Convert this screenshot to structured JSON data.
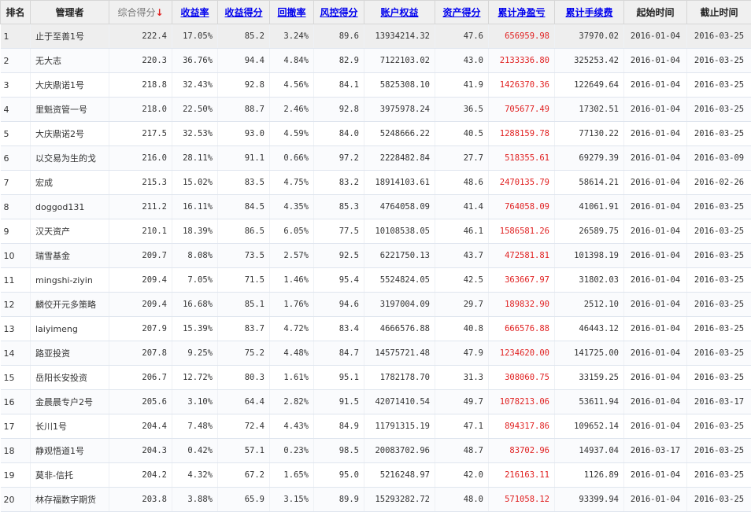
{
  "headers": [
    "排名",
    "管理者",
    "综合得分",
    "收益率",
    "收益得分",
    "回撤率",
    "风控得分",
    "账户权益",
    "资产得分",
    "累计净盈亏",
    "累计手续费",
    "起始时间",
    "截止时间"
  ],
  "sort_arrow": "↓",
  "rows": [
    [
      "1",
      "止于至善1号",
      "222.4",
      "17.05%",
      "85.2",
      "3.24%",
      "89.6",
      "13934214.32",
      "47.6",
      "656959.98",
      "37970.02",
      "2016-01-04",
      "2016-03-25"
    ],
    [
      "2",
      "无大志",
      "220.3",
      "36.76%",
      "94.4",
      "4.84%",
      "82.9",
      "7122103.02",
      "43.0",
      "2133336.80",
      "325253.42",
      "2016-01-04",
      "2016-03-25"
    ],
    [
      "3",
      "大庆鼎诺1号",
      "218.8",
      "32.43%",
      "92.8",
      "4.56%",
      "84.1",
      "5825308.10",
      "41.9",
      "1426370.36",
      "122649.64",
      "2016-01-04",
      "2016-03-25"
    ],
    [
      "4",
      "里魁资管一号",
      "218.0",
      "22.50%",
      "88.7",
      "2.46%",
      "92.8",
      "3975978.24",
      "36.5",
      "705677.49",
      "17302.51",
      "2016-01-04",
      "2016-03-25"
    ],
    [
      "5",
      "大庆鼎诺2号",
      "217.5",
      "32.53%",
      "93.0",
      "4.59%",
      "84.0",
      "5248666.22",
      "40.5",
      "1288159.78",
      "77130.22",
      "2016-01-04",
      "2016-03-25"
    ],
    [
      "6",
      "以交易为生的戈",
      "216.0",
      "28.11%",
      "91.1",
      "0.66%",
      "97.2",
      "2228482.84",
      "27.7",
      "518355.61",
      "69279.39",
      "2016-01-04",
      "2016-03-09"
    ],
    [
      "7",
      "宏成",
      "215.3",
      "15.02%",
      "83.5",
      "4.75%",
      "83.2",
      "18914103.61",
      "48.6",
      "2470135.79",
      "58614.21",
      "2016-01-04",
      "2016-02-26"
    ],
    [
      "8",
      "doggod131",
      "211.2",
      "16.11%",
      "84.5",
      "4.35%",
      "85.3",
      "4764058.09",
      "41.4",
      "764058.09",
      "41061.91",
      "2016-01-04",
      "2016-03-25"
    ],
    [
      "9",
      "汉天资产",
      "210.1",
      "18.39%",
      "86.5",
      "6.05%",
      "77.5",
      "10108538.05",
      "46.1",
      "1586581.26",
      "26589.75",
      "2016-01-04",
      "2016-03-25"
    ],
    [
      "10",
      "瑞雪基金",
      "209.7",
      "8.08%",
      "73.5",
      "2.57%",
      "92.5",
      "6221750.13",
      "43.7",
      "472581.81",
      "101398.19",
      "2016-01-04",
      "2016-03-25"
    ],
    [
      "11",
      "mingshi-ziyin",
      "209.4",
      "7.05%",
      "71.5",
      "1.46%",
      "95.4",
      "5524824.05",
      "42.5",
      "363667.97",
      "31802.03",
      "2016-01-04",
      "2016-03-25"
    ],
    [
      "12",
      "麟佼开元多策略",
      "209.4",
      "16.68%",
      "85.1",
      "1.76%",
      "94.6",
      "3197004.09",
      "29.7",
      "189832.90",
      "2512.10",
      "2016-01-04",
      "2016-03-25"
    ],
    [
      "13",
      "laiyimeng",
      "207.9",
      "15.39%",
      "83.7",
      "4.72%",
      "83.4",
      "4666576.88",
      "40.8",
      "666576.88",
      "46443.12",
      "2016-01-04",
      "2016-03-25"
    ],
    [
      "14",
      "路亚投资",
      "207.8",
      "9.25%",
      "75.2",
      "4.48%",
      "84.7",
      "14575721.48",
      "47.9",
      "1234620.00",
      "141725.00",
      "2016-01-04",
      "2016-03-25"
    ],
    [
      "15",
      "岳阳长安投资",
      "206.7",
      "12.72%",
      "80.3",
      "1.61%",
      "95.1",
      "1782178.70",
      "31.3",
      "308060.75",
      "33159.25",
      "2016-01-04",
      "2016-03-25"
    ],
    [
      "16",
      "金晨晨专户2号",
      "205.6",
      "3.10%",
      "64.4",
      "2.82%",
      "91.5",
      "42071410.54",
      "49.7",
      "1078213.06",
      "53611.94",
      "2016-01-04",
      "2016-03-17"
    ],
    [
      "17",
      "长川1号",
      "204.4",
      "7.48%",
      "72.4",
      "4.43%",
      "84.9",
      "11791315.19",
      "47.1",
      "894317.86",
      "109652.14",
      "2016-01-04",
      "2016-03-25"
    ],
    [
      "18",
      "静观悟道1号",
      "204.3",
      "0.42%",
      "57.1",
      "0.23%",
      "98.5",
      "20083702.96",
      "48.7",
      "83702.96",
      "14937.04",
      "2016-03-17",
      "2016-03-25"
    ],
    [
      "19",
      "莫非-信托",
      "204.2",
      "4.32%",
      "67.2",
      "1.65%",
      "95.0",
      "5216248.97",
      "42.0",
      "216163.11",
      "1126.89",
      "2016-01-04",
      "2016-03-25"
    ],
    [
      "20",
      "林存福数字期货",
      "203.8",
      "3.88%",
      "65.9",
      "3.15%",
      "89.9",
      "15293282.72",
      "48.0",
      "571058.12",
      "93399.94",
      "2016-01-04",
      "2016-03-25"
    ]
  ],
  "colors": {
    "negative_profit_text": "#e02020",
    "header_link": "#0000ee",
    "header_bg": "#f0f0f0"
  }
}
